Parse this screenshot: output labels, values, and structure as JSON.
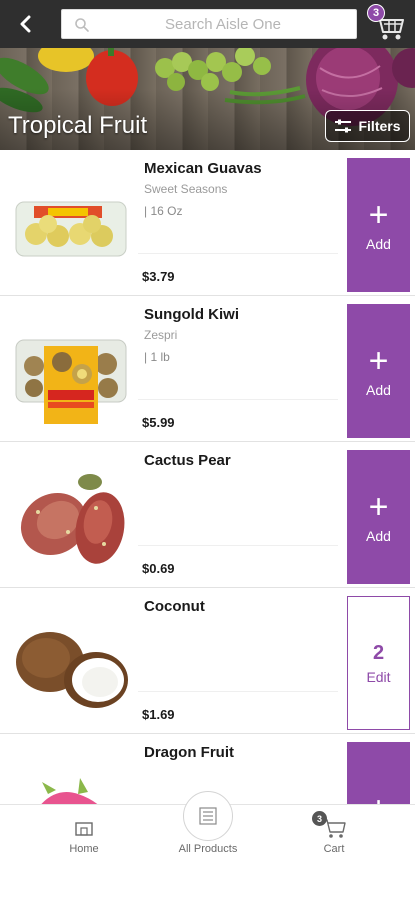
{
  "search": {
    "placeholder": "Search Aisle One"
  },
  "cart": {
    "count": "3"
  },
  "category": {
    "title": "Tropical Fruit",
    "filters_label": "Filters"
  },
  "products": [
    {
      "name": "Mexican Guavas",
      "brand": "Sweet Seasons",
      "size": "| 16 Oz",
      "price": "$3.79",
      "action_label": "Add"
    },
    {
      "name": "Sungold Kiwi",
      "brand": "Zespri",
      "size": "| 1 lb",
      "price": "$5.99",
      "action_label": "Add"
    },
    {
      "name": "Cactus Pear",
      "brand": "",
      "size": "",
      "price": "$0.69",
      "action_label": "Add"
    },
    {
      "name": "Coconut",
      "brand": "",
      "size": "",
      "price": "$1.69",
      "action_label": "Edit",
      "quantity": "2"
    },
    {
      "name": "Dragon Fruit",
      "brand": "",
      "size": "",
      "price": "",
      "action_label": ""
    }
  ],
  "bottom_nav": {
    "home": "Home",
    "all_products": "All Products",
    "cart": "Cart",
    "cart_count": "3"
  },
  "icons": [
    "back-arrow-icon",
    "search-icon",
    "cart-icon",
    "filters-icon",
    "home-icon",
    "list-icon",
    "cart-icon"
  ],
  "colors": {
    "accent": "#8e4aa8",
    "topbar": "#2f2f2f"
  }
}
